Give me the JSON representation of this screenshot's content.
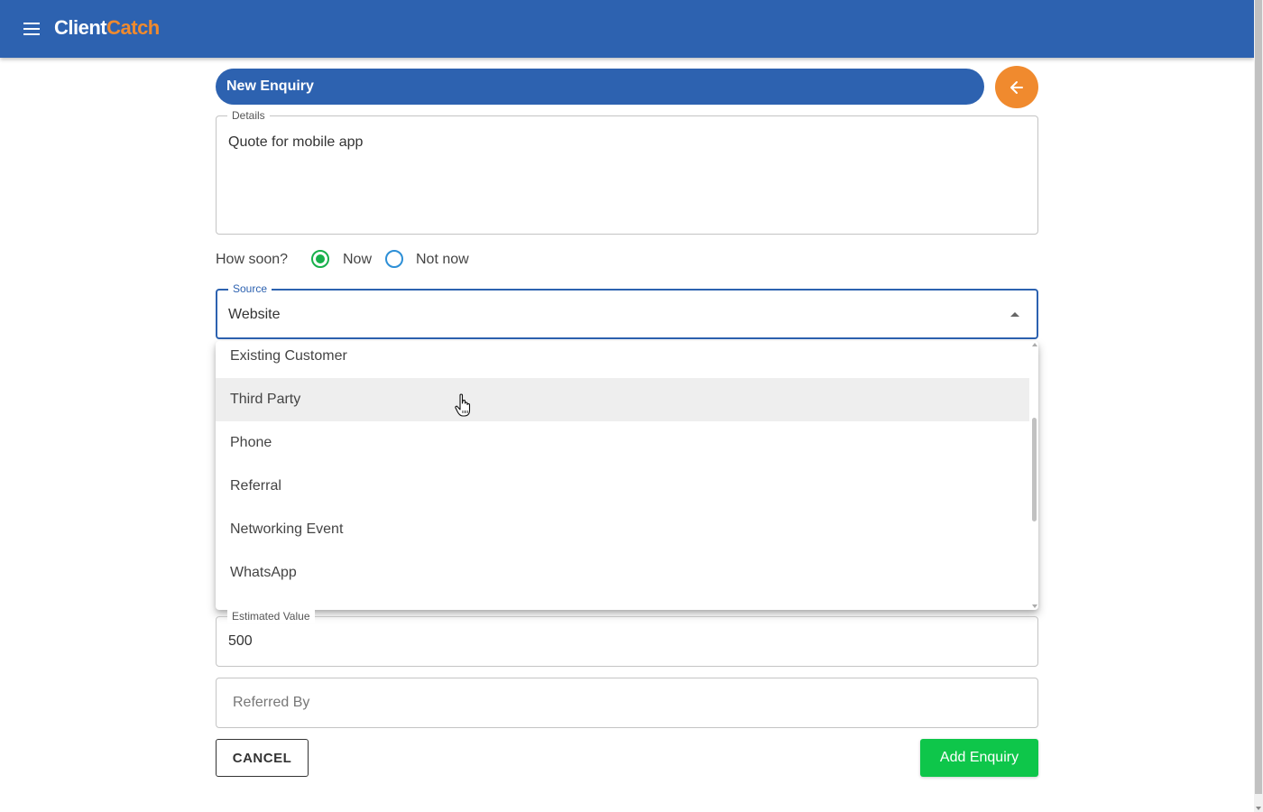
{
  "app": {
    "logo_part1": "Client",
    "logo_part2": "Catch",
    "brand_color": "#2d62b0",
    "accent_color": "#f08a2e"
  },
  "page": {
    "title": "New Enquiry"
  },
  "details": {
    "legend": "Details",
    "value": "Quote for mobile app"
  },
  "how_soon": {
    "label": "How soon?",
    "options": [
      {
        "label": "Now",
        "selected": true
      },
      {
        "label": "Not now",
        "selected": false
      }
    ]
  },
  "source": {
    "legend": "Source",
    "value": "Website",
    "options": [
      "Existing Customer",
      "Third Party",
      "Phone",
      "Referral",
      "Networking Event",
      "WhatsApp"
    ],
    "hovered_option": "Third Party"
  },
  "estimated_value": {
    "legend": "Estimated Value",
    "value": "500"
  },
  "referred_by": {
    "placeholder": "Referred By"
  },
  "actions": {
    "cancel_label": "CANCEL",
    "add_label": "Add Enquiry",
    "add_color": "#0ec64a"
  }
}
